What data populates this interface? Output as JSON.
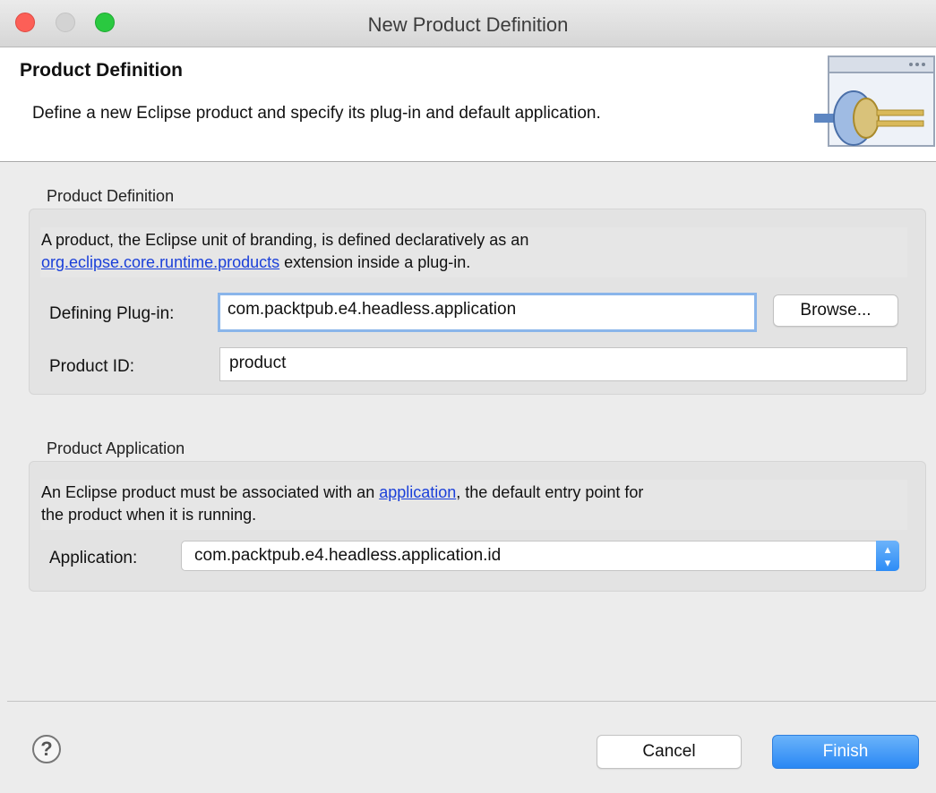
{
  "window": {
    "title": "New Product Definition"
  },
  "banner": {
    "title": "Product Definition",
    "description": "Define a new Eclipse product and specify its plug-in and default application."
  },
  "product_definition": {
    "group_label": "Product Definition",
    "desc_before_link": "A product, the Eclipse unit of branding, is defined declaratively as an",
    "link": "org.eclipse.core.runtime.products",
    "desc_after_link": " extension inside a plug-in.",
    "defining_plugin_label": "Defining Plug-in:",
    "defining_plugin_value": "com.packtpub.e4.headless.application",
    "browse_label": "Browse...",
    "product_id_label": "Product ID:",
    "product_id_value": "product"
  },
  "product_application": {
    "group_label": "Product Application",
    "desc_before_link": "An Eclipse product must be associated with an  ",
    "link": "application",
    "desc_after_link": ", the default entry point for",
    "desc_line2": "the product when it is running.",
    "application_label": "Application:",
    "application_value": "com.packtpub.e4.headless.application.id"
  },
  "footer": {
    "help_symbol": "?",
    "cancel_label": "Cancel",
    "finish_label": "Finish"
  },
  "colors": {
    "accent": "#2a88f4",
    "link": "#1a3fd9",
    "close": "#fc5f57",
    "maximize": "#2ac940"
  }
}
